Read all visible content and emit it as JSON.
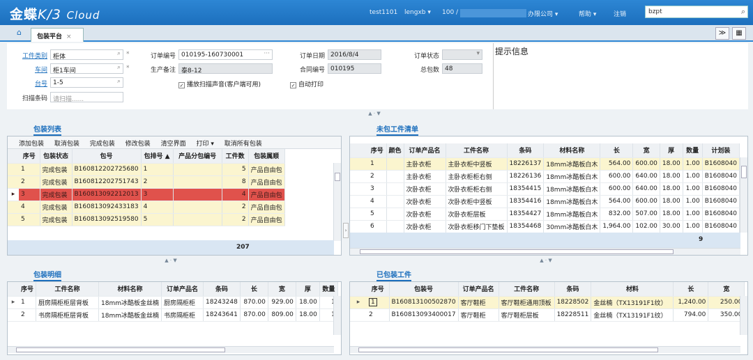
{
  "header": {
    "logo_main": "金蝶",
    "logo_sub": "K/3",
    "logo_cloud": "Cloud",
    "user": "test1101",
    "account": "lengxb ▾",
    "org_code": "100 /",
    "org_name": "办限公司 ▾",
    "help": "帮助 ▾",
    "logout": "注销",
    "search_value": "bzpt",
    "search_icon": "search-icon"
  },
  "tabs": {
    "home_icon": "home-icon",
    "active_label": "包装平台",
    "close_glyph": "×",
    "btn_expand": "≫",
    "btn_grid": "▦"
  },
  "form": {
    "work_type_label": "工件类别",
    "work_type_value": "柜体",
    "workshop_label": "车间",
    "workshop_value": "柜1车间",
    "station_label": "台号",
    "station_value": "1-5",
    "scan_label": "扫描条码",
    "scan_placeholder": "请扫描......",
    "order_no_label": "订单编号",
    "order_no_value": "010195-160730001",
    "remark_label": "生产备注",
    "remark_value": "泰8-12",
    "beep_label": "播放扫描声音(客户端可用)",
    "order_date_label": "订单日期",
    "order_date_value": "2016/8/4",
    "contract_label": "合同编号",
    "contract_value": "010195",
    "auto_print_label": "自动打印",
    "order_status_label": "订单状态",
    "order_status_value": "",
    "total_pkg_label": "总包数",
    "total_pkg_value": "48",
    "required_mark": "*",
    "lookup_glyph": "⌕",
    "more_glyph": "···",
    "check_glyph": "✓"
  },
  "tips_title": "提示信息",
  "splitter_glyph": "▲ · ▼",
  "pack_list": {
    "title": "包装列表",
    "toolbar": [
      "添加包装",
      "取消包装",
      "完成包装",
      "修改包装",
      "清空界面",
      "打印 ▾",
      "取消所有包装"
    ],
    "columns": [
      "序号",
      "包装状态",
      "包号",
      "包排号 ▲",
      "产品分包编号",
      "工件数",
      "包装属顺"
    ],
    "rows": [
      {
        "seq": "1",
        "status": "完成包装",
        "code": "B160812202725680",
        "pos": "1",
        "sub": "",
        "count": "5",
        "attr": "产品自由包"
      },
      {
        "seq": "2",
        "status": "完成包装",
        "code": "B160812202751743",
        "pos": "2",
        "sub": "",
        "count": "8",
        "attr": "产品自由包"
      },
      {
        "seq": "3",
        "status": "完成包装",
        "code": "B160813092212013",
        "pos": "3",
        "sub": "",
        "count": "4",
        "attr": "产品自由包"
      },
      {
        "seq": "4",
        "status": "完成包装",
        "code": "B160813092433183",
        "pos": "4",
        "sub": "",
        "count": "2",
        "attr": "产品自由包"
      },
      {
        "seq": "5",
        "status": "完成包装",
        "code": "B160813092519580",
        "pos": "5",
        "sub": "",
        "count": "2",
        "attr": "产品自由包"
      }
    ],
    "total": "207",
    "row_pointer": "▸"
  },
  "unpacked": {
    "title": "未包工件清单",
    "columns": [
      "序号",
      "颜色",
      "订单产品名",
      "工件名称",
      "条码",
      "材料名称",
      "长",
      "宽",
      "厚",
      "数量",
      "计划装"
    ],
    "rows": [
      {
        "seq": "1",
        "color": "",
        "product": "主卧衣柜",
        "part": "主卧衣柜中竖板",
        "code": "18226137",
        "mat": "18mm冰酷板白木",
        "l": "564.00",
        "w": "600.00",
        "t": "18.00",
        "q": "1.00",
        "plan": "B1608040"
      },
      {
        "seq": "2",
        "color": "",
        "product": "主卧衣柜",
        "part": "主卧衣柜柜右侧",
        "code": "18226136",
        "mat": "18mm冰酷板白木",
        "l": "600.00",
        "w": "640.00",
        "t": "18.00",
        "q": "1.00",
        "plan": "B1608040"
      },
      {
        "seq": "3",
        "color": "",
        "product": "次卧衣柜",
        "part": "次卧衣柜柜右侧",
        "code": "18354415",
        "mat": "18mm冰酷板白木",
        "l": "600.00",
        "w": "640.00",
        "t": "18.00",
        "q": "1.00",
        "plan": "B1608040"
      },
      {
        "seq": "4",
        "color": "",
        "product": "次卧衣柜",
        "part": "次卧衣柜中竖板",
        "code": "18354416",
        "mat": "18mm冰酷板白木",
        "l": "564.00",
        "w": "600.00",
        "t": "18.00",
        "q": "1.00",
        "plan": "B1608040"
      },
      {
        "seq": "5",
        "color": "",
        "product": "次卧衣柜",
        "part": "次卧衣柜层板",
        "code": "18354427",
        "mat": "18mm冰酷板白木",
        "l": "832.00",
        "w": "507.00",
        "t": "18.00",
        "q": "1.00",
        "plan": "B1608040"
      },
      {
        "seq": "6",
        "color": "",
        "product": "次卧衣柜",
        "part": "次卧衣柜移门下垫板",
        "code": "18354468",
        "mat": "30mm冰酷板白木",
        "l": "1,964.00",
        "w": "102.00",
        "t": "30.00",
        "q": "1.00",
        "plan": "B1608040"
      }
    ],
    "total": "9"
  },
  "pack_detail": {
    "title": "包装明细",
    "columns": [
      "序号",
      "工件名称",
      "材料名称",
      "订单产品名",
      "条码",
      "长",
      "宽",
      "厚",
      "数量"
    ],
    "rows": [
      {
        "seq": "1",
        "part": "厨房隔柜柜层背板",
        "mat": "18mm冰酷板金丝楠",
        "product": "厨房隔柜柜",
        "code": "18243248",
        "l": "870.00",
        "w": "929.00",
        "t": "18.00",
        "q": "1"
      },
      {
        "seq": "2",
        "part": "书房隔柜柜层背板",
        "mat": "18mm冰酷板金丝楠",
        "product": "书房隔柜柜",
        "code": "18243641",
        "l": "870.00",
        "w": "809.00",
        "t": "18.00",
        "q": "1"
      }
    ]
  },
  "packed": {
    "title": "已包装工件",
    "columns": [
      "序号",
      "包装号",
      "订单产品名",
      "工件名称",
      "条码",
      "材料",
      "长",
      "宽"
    ],
    "rows": [
      {
        "seq": "1",
        "pkg": "B160813100502870",
        "product": "客厅鞋柜",
        "part": "客厅鞋柜通用顶板",
        "code": "18228502",
        "mat": "金丝楠（TX13191F1纹）",
        "l": "1,240.00",
        "w": "250.00"
      },
      {
        "seq": "2",
        "pkg": "B160813093400017",
        "product": "客厅鞋柜",
        "part": "客厅鞋柜层板",
        "code": "18228511",
        "mat": "金丝楠（TX13191F1纹）",
        "l": "794.00",
        "w": "350.00"
      }
    ]
  },
  "colors": {
    "accent": "#1c6fbd",
    "selected_row": "#e0524c",
    "stripe_row": "#fbf5cf"
  }
}
